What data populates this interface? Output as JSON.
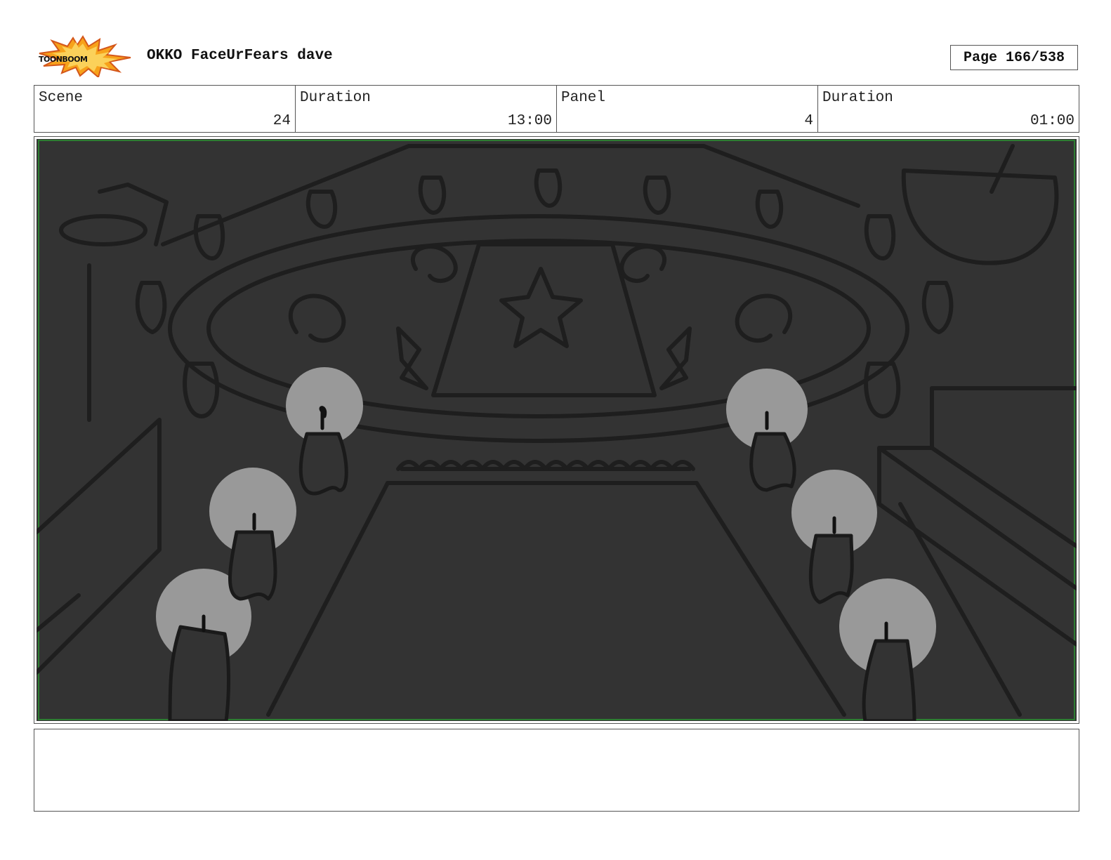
{
  "header": {
    "logo_text": "TOONBOOM",
    "title": "OKKO FaceUrFears dave",
    "page": "Page 166/538"
  },
  "info": {
    "scene_label": "Scene",
    "scene_value": "24",
    "scene_duration_label": "Duration",
    "scene_duration_value": "13:00",
    "panel_label": "Panel",
    "panel_value": "4",
    "panel_duration_label": "Duration",
    "panel_duration_value": "01:00"
  },
  "panel": {
    "background_color": "#333333",
    "frame_color": "#2e7d32"
  },
  "notes": {
    "text": ""
  }
}
